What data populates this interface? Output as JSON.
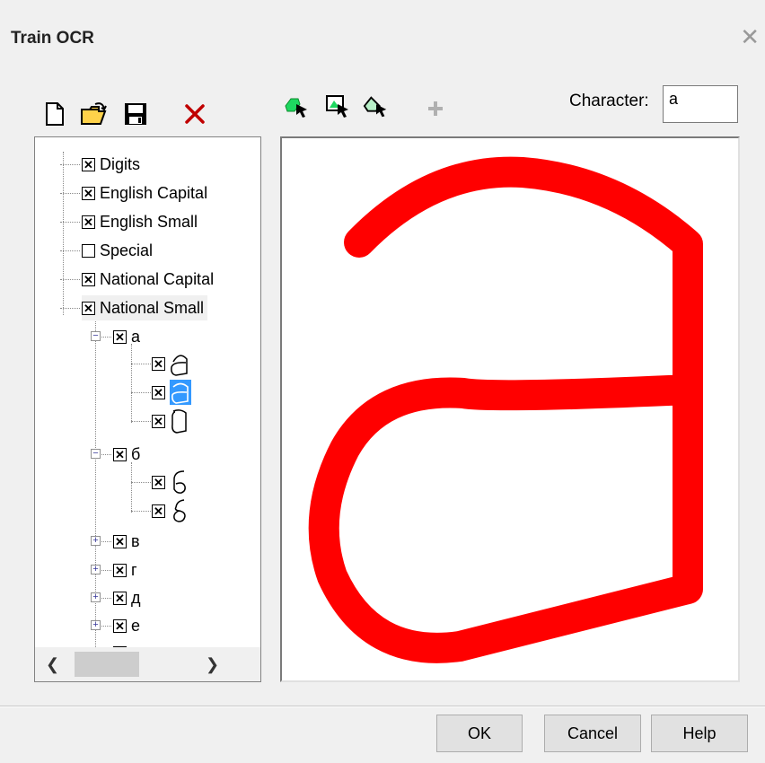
{
  "window": {
    "title": "Train OCR"
  },
  "toolbar": {
    "icons": [
      "new-file-icon",
      "open-folder-icon",
      "save-icon",
      "delete-icon",
      "select-region-icon",
      "add-frame-icon",
      "select-area-icon",
      "plus-icon"
    ],
    "character_label": "Character:",
    "character_value": "a"
  },
  "tree": {
    "groups": [
      {
        "label": "Digits",
        "checked": true
      },
      {
        "label": "English Capital",
        "checked": true
      },
      {
        "label": "English Small",
        "checked": true
      },
      {
        "label": "Special",
        "checked": false
      },
      {
        "label": "National Capital",
        "checked": true
      },
      {
        "label": "National Small",
        "checked": true
      }
    ],
    "chars": [
      {
        "label": "а",
        "expanded": true,
        "samples": 3
      },
      {
        "label": "б",
        "expanded": true,
        "samples": 2
      },
      {
        "label": "в",
        "expanded": false
      },
      {
        "label": "г",
        "expanded": false
      },
      {
        "label": "д",
        "expanded": false
      },
      {
        "label": "е",
        "expanded": false
      }
    ],
    "selected_sample": "а-2"
  },
  "buttons": {
    "ok": "OK",
    "cancel": "Cancel",
    "help": "Help"
  },
  "colors": {
    "stroke": "#ff0000",
    "selection": "#3399ff"
  }
}
